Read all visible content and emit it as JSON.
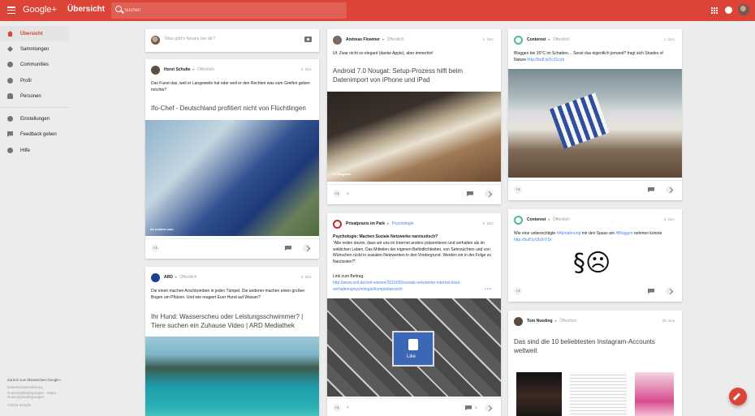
{
  "app": {
    "brand": "Google+",
    "page_title": "Übersicht"
  },
  "search": {
    "placeholder": "Suchen"
  },
  "colors": {
    "brand_red": "#db4437",
    "link_blue": "#4285f4"
  },
  "sidebar": {
    "items": [
      {
        "label": "Übersicht",
        "icon": "home-icon",
        "active": true
      },
      {
        "label": "Sammlungen",
        "icon": "collections-icon"
      },
      {
        "label": "Communities",
        "icon": "communities-icon"
      },
      {
        "label": "Profil",
        "icon": "profile-icon"
      },
      {
        "label": "Personen",
        "icon": "people-icon"
      },
      {
        "label": "Einstellungen",
        "icon": "settings-icon"
      },
      {
        "label": "Feedback geben",
        "icon": "feedback-icon"
      },
      {
        "label": "Hilfe",
        "icon": "help-icon"
      }
    ],
    "footer": {
      "classic": "Zurück zum klassischen Google+",
      "privacy": "Datenschutzerklärung",
      "terms": "Nutzungsbedingungen · Maps-Nutzungsbedingungen",
      "copyright": "©2016 Google"
    }
  },
  "composer": {
    "placeholder": "Was gibt's Neues bei dir?"
  },
  "posts": {
    "horst": {
      "author": "Horst Schulte",
      "audience": "Öffentlich",
      "date": "4. Dez.",
      "text": "Das Fuest das, weil er Langeweile hat oder weil er den Rechten was zum Greifen geben möchte?",
      "link_title": "Ifo-Chef - Deutschland profitiert nicht von Flüchtlingen",
      "source": "de.reuters.com",
      "plus": "+1"
    },
    "ard": {
      "author": "ARD",
      "audience": "Öffentlich",
      "date": "3. Dez.",
      "text": "Die einen machen Arschbomben in jeden Tümpel. Die anderen machen einen großen Bogen um Pfützen. Und wie reagiert Euer Hund auf Wasser?",
      "link_title": "Ihr Hund: Wasserscheu oder Leistungsschwimmer? | Tiere suchen ein Zuhause Video | ARD Mediathek"
    },
    "andreas": {
      "author": "Andreas Flowmer",
      "audience": "Öffentlich",
      "date": "4. Dez.",
      "text": "Uf. Zwar nicht so elegant (danke Apple), aber immerhin!",
      "link_title": "Android 7.0 Nougat: Setup-Prozess hilft beim Datenimport von iPhone und iPad",
      "source": "t3n Magazin",
      "plus": "+1",
      "plus_count": "2"
    },
    "privatpraxis": {
      "author": "Privatpraxis im Park",
      "audience": "Psychologie",
      "date": "2. Dez.",
      "headline": "Psychologie: Machen Soziale Netzwerke narzisstisch?",
      "text": "\"Alle reden davon, dass wir uns im Internet anders präsentieren und verhalten als im wirklichen Leben. Das Mitteilen der eigenen Befindlichkeiten, von Sehnsüchten und von Wünschen rückt in sozialen Netzwerken in den Vordergrund. Werden wir in der Folge zu Narzissten?\"",
      "link_label": "Link zum Beitrag:",
      "link_url": "http://www.zeit.de/zeit-wissen/2016/05/soziale-netzwerke-internet-likes-verhaltenspsychologie/komplettansicht",
      "more": "• • •",
      "like_label": "Like",
      "plus": "+1",
      "plus_count": "7",
      "comment_count": "1"
    },
    "conterest1": {
      "author": "Conterest",
      "audience": "Öffentlich",
      "date": "1. Dez.",
      "text": "Bloggen bei 35°C im Schatten… Sesst das eigentlich jemand? fragt sich Shades of Nature",
      "link": "http://buff.ly/2c31cyb",
      "plus": "+1"
    },
    "conterest2": {
      "author": "Conterest",
      "audience": "Öffentlich",
      "date": "3. Dez.",
      "text_1": "Wie eine unberechtigte",
      "hashtag_1": "#Abmahnung",
      "text_2": "mir den Spass am",
      "hashtag_2": "#Bloggen",
      "text_3": "nehmen konnte",
      "link": "http://buff.ly/2bJoY1k",
      "image_text": "§☹",
      "plus": "+1"
    },
    "tom": {
      "author": "Tom Noeding",
      "audience": "Öffentlich",
      "date": "28. Nov.",
      "link_title": "Das sind die 10 beliebtesten Instagram-Accounts weltweit"
    }
  }
}
